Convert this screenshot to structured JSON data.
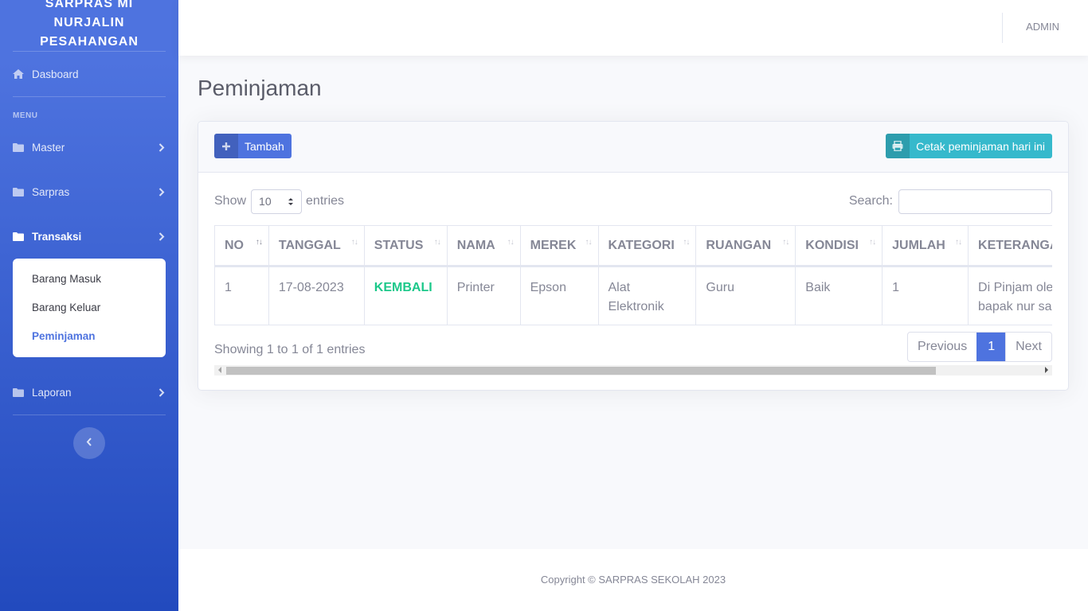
{
  "sidebar": {
    "brand": "SARPRAS MI NURJALIN PESAHANGAN",
    "dashboard": {
      "label": "Dasboard",
      "icon": "home-icon"
    },
    "heading": "MENU",
    "items": [
      {
        "label": "Master",
        "icon": "folder-icon"
      },
      {
        "label": "Sarpras",
        "icon": "folder-icon"
      },
      {
        "label": "Transaksi",
        "icon": "folder-icon",
        "active": true
      },
      {
        "label": "Laporan",
        "icon": "folder-icon"
      }
    ],
    "submenu": [
      {
        "label": "Barang Masuk"
      },
      {
        "label": "Barang Keluar"
      },
      {
        "label": "Peminjaman",
        "active": true
      }
    ]
  },
  "topbar": {
    "user": "ADMIN"
  },
  "page": {
    "title": "Peminjaman"
  },
  "toolbar": {
    "add_label": "Tambah",
    "print_label": "Cetak peminjaman hari ini"
  },
  "table_controls": {
    "show_label": "Show",
    "entries_value": "10",
    "entries_label": "entries",
    "search_label": "Search:",
    "search_placeholder": ""
  },
  "table": {
    "headers": [
      "NO",
      "TANGGAL",
      "STATUS",
      "NAMA",
      "MEREK",
      "KATEGORI",
      "RUANGAN",
      "KONDISI",
      "JUMLAH",
      "KETERANGAN"
    ],
    "rows": [
      {
        "no": "1",
        "tanggal": "17-08-2023",
        "status": "KEMBALI",
        "nama": "Printer",
        "merek": "Epson",
        "kategori_line1": "Alat",
        "kategori_line2": "Elektronik",
        "ruangan": "Guru",
        "kondisi": "Baik",
        "jumlah": "1",
        "keterangan_line1": "Di Pinjam oleh",
        "keterangan_line2": "bapak nur sa"
      }
    ]
  },
  "pagination": {
    "info": "Showing 1 to 1 of 1 entries",
    "previous": "Previous",
    "current": "1",
    "next": "Next"
  },
  "footer": {
    "copyright": "Copyright © SARPRAS SEKOLAH 2023"
  },
  "colors": {
    "primary": "#4e73df",
    "info": "#36b9cc",
    "success": "#1cc88a"
  }
}
